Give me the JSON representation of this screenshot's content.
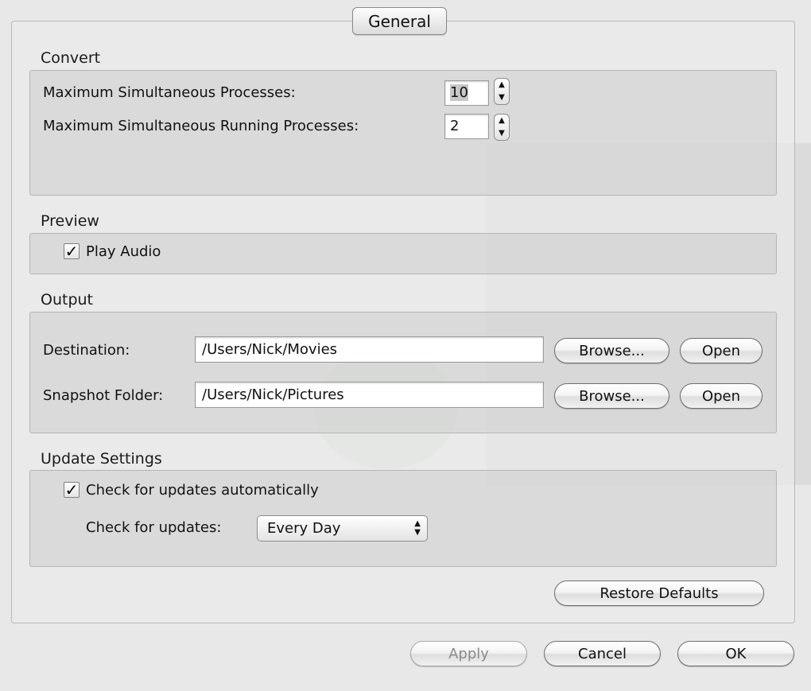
{
  "tab": {
    "label": "General"
  },
  "convert": {
    "title": "Convert",
    "max_processes_label": "Maximum Simultaneous Processes:",
    "max_processes_value": "10",
    "max_running_label": "Maximum Simultaneous Running Processes:",
    "max_running_value": "2"
  },
  "preview": {
    "title": "Preview",
    "play_audio_label": "Play Audio",
    "play_audio_checked": true
  },
  "output": {
    "title": "Output",
    "destination_label": "Destination:",
    "destination_value": "/Users/Nick/Movies",
    "snapshot_label": "Snapshot Folder:",
    "snapshot_value": "/Users/Nick/Pictures",
    "browse_label": "Browse...",
    "open_label": "Open"
  },
  "updates": {
    "title": "Update Settings",
    "auto_label": "Check for updates automatically",
    "auto_checked": true,
    "frequency_label": "Check for updates:",
    "frequency_value": "Every Day"
  },
  "buttons": {
    "restore_defaults": "Restore Defaults",
    "apply": "Apply",
    "cancel": "Cancel",
    "ok": "OK"
  },
  "icons": {
    "checkmark": "checkmark-icon",
    "stepper": "stepper-arrows-icon",
    "popup": "popup-arrows-icon"
  }
}
